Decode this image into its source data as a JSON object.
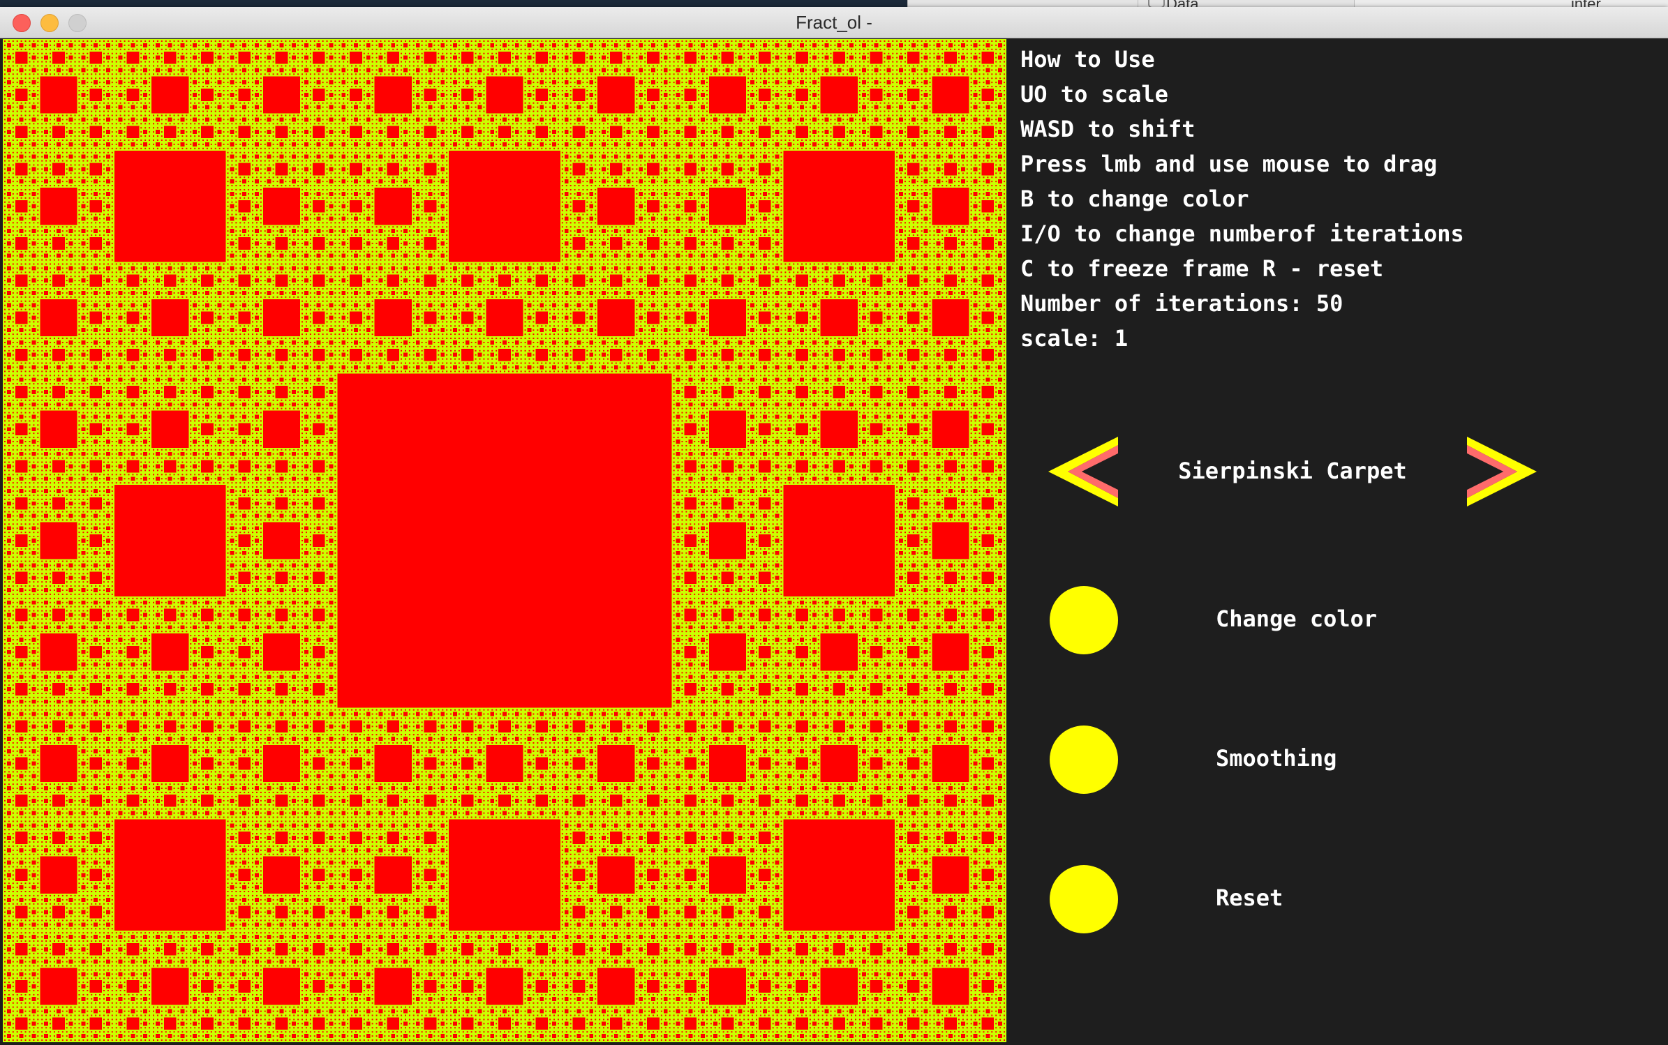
{
  "window": {
    "title": "Fract_ol -"
  },
  "background_tabs": {
    "tab2": "Data",
    "tab3": "inter"
  },
  "help": {
    "lines": [
      "How to Use",
      "UO to scale",
      "WASD to shift",
      "Press lmb and use mouse to drag",
      "B to change color",
      "I/O to change numberof iterations",
      "C to freeze frame R - reset",
      "Number of iterations: 50",
      "scale: 1"
    ]
  },
  "fractal": {
    "name": "Sierpinski Carpet",
    "colors": {
      "fill": "#ff0000",
      "hole_background": "#ccff00"
    }
  },
  "options": [
    {
      "label": "Change color",
      "icon": "toggle-circle-icon"
    },
    {
      "label": "Smoothing",
      "icon": "toggle-circle-icon"
    },
    {
      "label": "Reset",
      "icon": "toggle-circle-icon"
    }
  ],
  "colors": {
    "panel_bg": "#1e1e1e",
    "accent": "#ffff00",
    "arrow_inner": "#ff6b6b"
  }
}
